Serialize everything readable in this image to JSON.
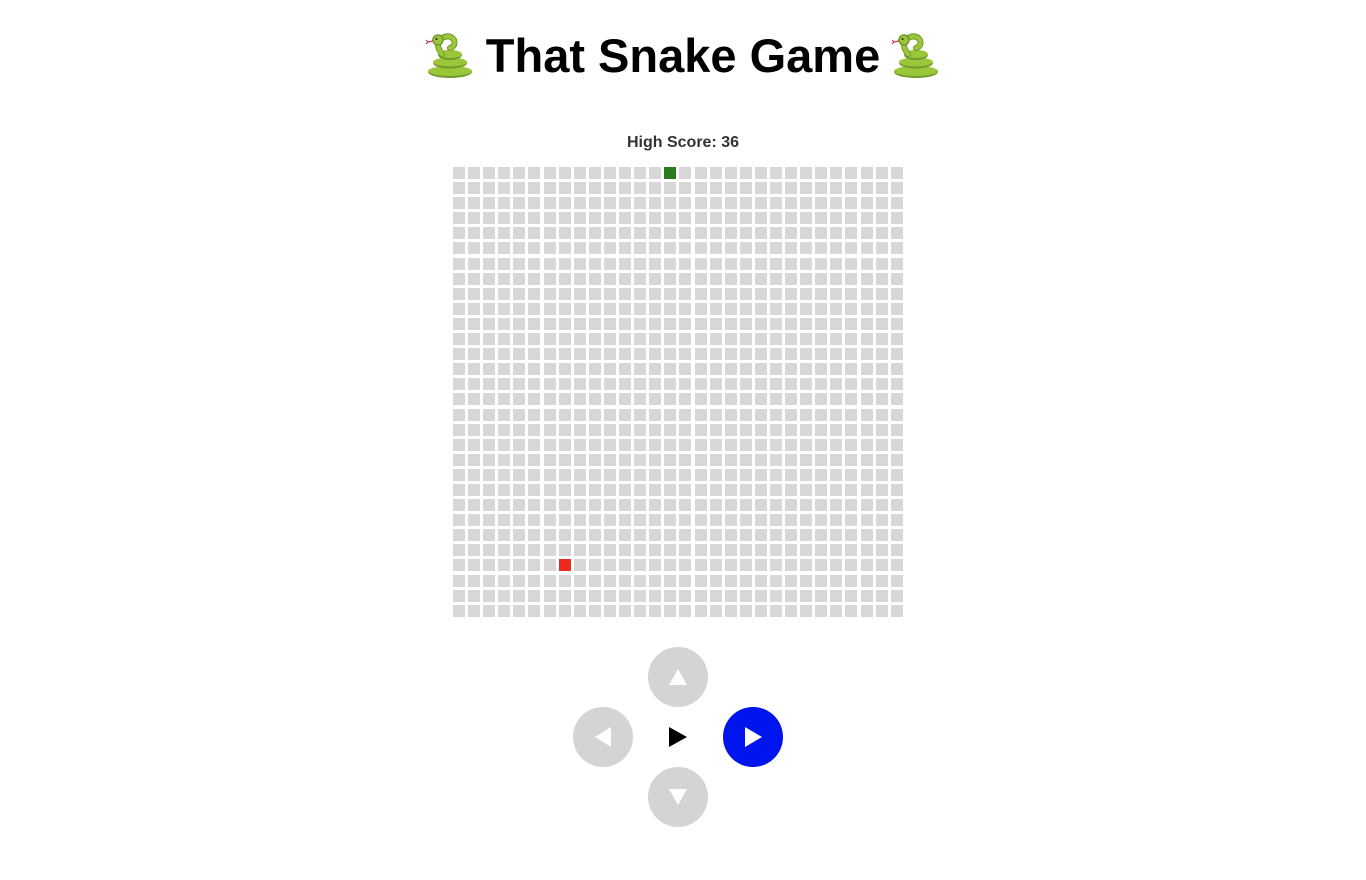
{
  "title": {
    "text": "That Snake Game",
    "icon": "snake-icon"
  },
  "score": {
    "label": "High Score: 36"
  },
  "board": {
    "columns": 30,
    "rows": 30,
    "snake": [
      [
        14,
        0
      ]
    ],
    "food": [
      7,
      26
    ]
  },
  "controls": {
    "up_icon": "triangle-up-icon",
    "left_icon": "triangle-left-icon",
    "right_icon": "triangle-right-icon",
    "down_icon": "triangle-down-icon",
    "play_icon": "play-icon"
  },
  "colors": {
    "cell": "#d7d7d7",
    "snake": "#2a7a1e",
    "food": "#ee2a1f",
    "active_control": "#0014ee",
    "control": "#d4d4d4"
  }
}
